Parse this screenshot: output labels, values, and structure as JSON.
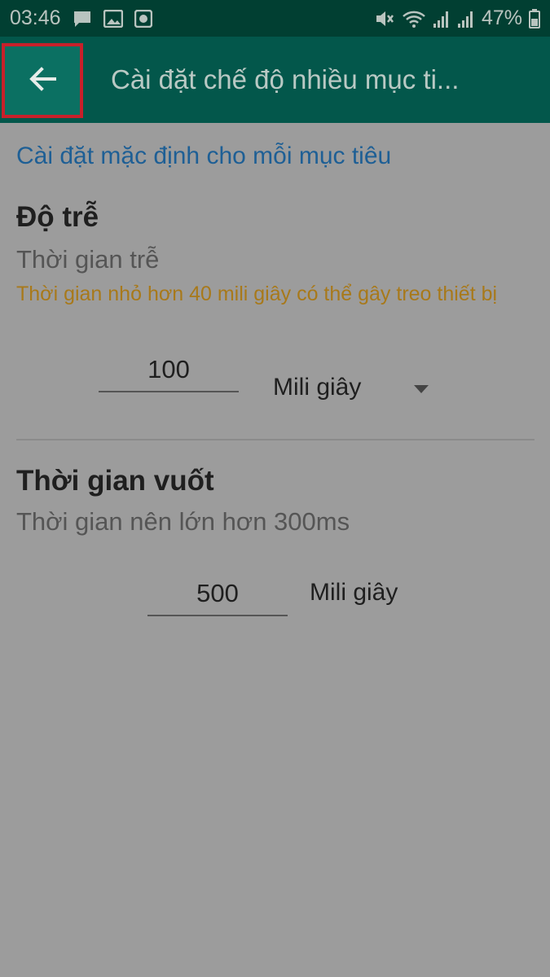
{
  "status_bar": {
    "time": "03:46",
    "battery_percent": "47%",
    "icons_left": [
      "chat-icon",
      "image-icon",
      "record-icon"
    ],
    "icons_right": [
      "mute-icon",
      "wifi-icon",
      "signal-icon",
      "signal-icon",
      "battery-icon"
    ]
  },
  "app_bar": {
    "back_icon": "arrow-left-icon",
    "title": "Cài đặt chế độ nhiều mục ti..."
  },
  "content": {
    "section_link": "Cài đặt mặc định cho mỗi mục tiêu",
    "delay": {
      "heading": "Độ trễ",
      "subtitle": "Thời gian trễ",
      "warning": "Thời gian nhỏ hơn 40 mili giây có thể gây treo thiết bị",
      "value": "100",
      "unit": "Mili giây"
    },
    "swipe": {
      "heading": "Thời gian vuốt",
      "subtitle": "Thời gian nên lớn hơn 300ms",
      "value": "500",
      "unit": "Mili giây"
    }
  },
  "colors": {
    "status_bar": "#013f32",
    "app_bar": "#03574b",
    "overlay_background": "#9c9c9c",
    "link": "#1e5f95",
    "warning": "#a8791a",
    "highlight_border": "#c8202a"
  }
}
